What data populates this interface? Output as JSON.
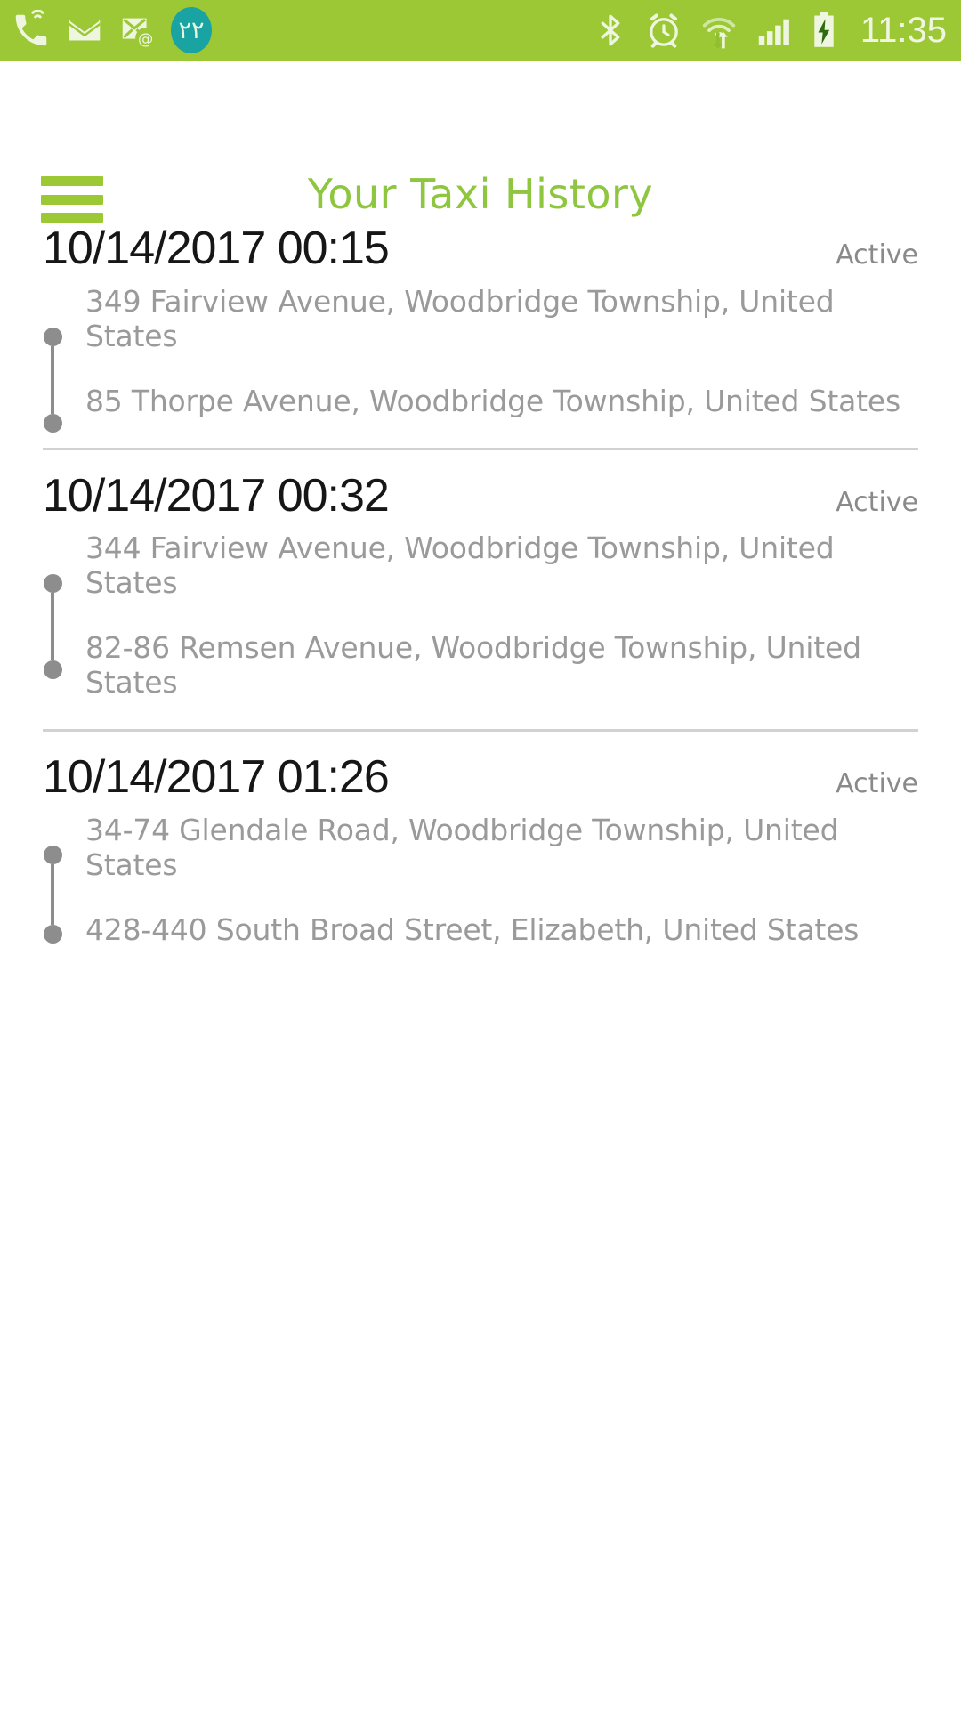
{
  "status_bar": {
    "background_color": "#9bc834",
    "time": "11:35",
    "notification_badge": "٢٢",
    "badge_color": "#1aa3a3",
    "left_icons": [
      "missed-call-wifi-icon",
      "envelope-icon",
      "email-sync-icon",
      "notification-count-badge"
    ],
    "right_icons": [
      "bluetooth-icon",
      "alarm-clock-icon",
      "wifi-data-transfer-icon",
      "cellular-signal-icon",
      "battery-charging-icon"
    ]
  },
  "header": {
    "title": "Your Taxi History",
    "title_color": "#8ec63f",
    "menu_icon": "hamburger-menu-icon"
  },
  "trips": [
    {
      "datetime": "10/14/2017 00:15",
      "status": "Active",
      "pickup": "349 Fairview Avenue, Woodbridge Township, United States",
      "dropoff": "85 Thorpe Avenue, Woodbridge Township, United States"
    },
    {
      "datetime": "10/14/2017 00:32",
      "status": "Active",
      "pickup": "344 Fairview Avenue, Woodbridge Township, United States",
      "dropoff": "82-86 Remsen Avenue, Woodbridge Township, United States"
    },
    {
      "datetime": "10/14/2017 01:26",
      "status": "Active",
      "pickup": "34-74 Glendale Road, Woodbridge Township, United States",
      "dropoff": "428-440 South Broad Street, Elizabeth, United States"
    }
  ]
}
